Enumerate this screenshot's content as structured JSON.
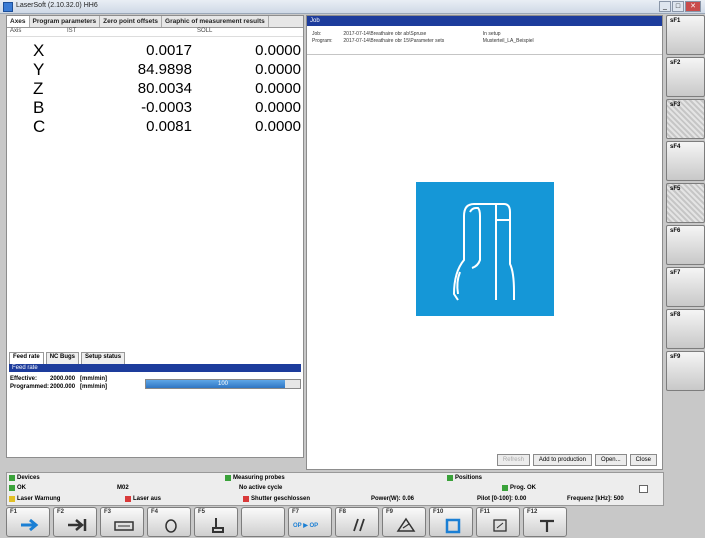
{
  "window": {
    "title": "LaserSoft (2.10.32.0) HH6"
  },
  "left_tabs": [
    "Axes",
    "Program parameters",
    "Zero point offsets",
    "Graphic of measurement results"
  ],
  "axis_header": {
    "axis": "Axis",
    "actual": "IST",
    "target": "SOLL"
  },
  "axes": [
    {
      "name": "X",
      "actual": "0.0017",
      "target": "0.0000"
    },
    {
      "name": "Y",
      "actual": "84.9898",
      "target": "0.0000"
    },
    {
      "name": "Z",
      "actual": "80.0034",
      "target": "0.0000"
    },
    {
      "name": "B",
      "actual": "-0.0003",
      "target": "0.0000"
    },
    {
      "name": "C",
      "actual": "0.0081",
      "target": "0.0000"
    }
  ],
  "subtabs": [
    "Feed rate",
    "NC Bugs",
    "Setup status"
  ],
  "feed": {
    "header": "Feed rate",
    "effective_label": "Effective:",
    "effective_value": "2000.000",
    "effective_unit": "[mm/min]",
    "programmed_label": "Programmed:",
    "programmed_value": "2000.000",
    "programmed_unit": "[mm/min]",
    "override_label": "100",
    "override_percent": 90
  },
  "right_panel": {
    "header": "Job",
    "job_label": "Job:",
    "job_value": "2017-07-14\\Breathaire obr ab\\Spruse",
    "job_state": "In setup",
    "program_label": "Program:",
    "program_value": "2017-07-14\\Breathaire obr 15\\Parameter sets",
    "program_name": "Musterteil_LA_Beispiel"
  },
  "dialog_buttons": {
    "refresh": "Refresh",
    "add": "Add to production",
    "open": "Open...",
    "close": "Close"
  },
  "softkeys": [
    "sF1",
    "sF2",
    "sF3",
    "sF4",
    "sF5",
    "sF6",
    "sF7",
    "sF8",
    "sF9"
  ],
  "status": {
    "devices": "Devices",
    "measuring_probes": "Measuring probes",
    "positions": "Positions",
    "ok": "OK",
    "code": "M02",
    "no_active_cycle": "No active cycle",
    "prog_ok": "Prog. OK",
    "laser_warning": "Laser Warnung",
    "laser_aus": "Laser aus",
    "shutter": "Shutter geschlossen",
    "power": "Power(W): 0.06",
    "pilot": "Pilot [0-100]: 0.00",
    "frequency": "Frequenz [kHz]: 500"
  },
  "fkeys": [
    {
      "label": "F1",
      "icon": "arrow-right-icon",
      "extra": ""
    },
    {
      "label": "F2",
      "icon": "arrow-to-line-icon",
      "extra": ""
    },
    {
      "label": "F3",
      "icon": "panel-icon",
      "extra": ""
    },
    {
      "label": "F4",
      "icon": "circle-arrow-icon",
      "extra": ""
    },
    {
      "label": "F5",
      "icon": "hand-icon",
      "extra": ""
    },
    {
      "label": "",
      "icon": "",
      "extra": ""
    },
    {
      "label": "F7",
      "icon": "",
      "extra": "OP ▶ OP"
    },
    {
      "label": "F8",
      "icon": "parallel-lines-icon",
      "extra": ""
    },
    {
      "label": "F9",
      "icon": "triangle-icon",
      "extra": ""
    },
    {
      "label": "F10",
      "icon": "folder-icon",
      "extra": ""
    },
    {
      "label": "F11",
      "icon": "window-icon",
      "extra": ""
    },
    {
      "label": "F12",
      "icon": "tool-icon",
      "extra": ""
    }
  ],
  "colors": {
    "accent_blue": "#1597d7",
    "header_navy": "#1d3c9c",
    "ok_green": "#3aa23a",
    "warn_red": "#d93a3a"
  }
}
